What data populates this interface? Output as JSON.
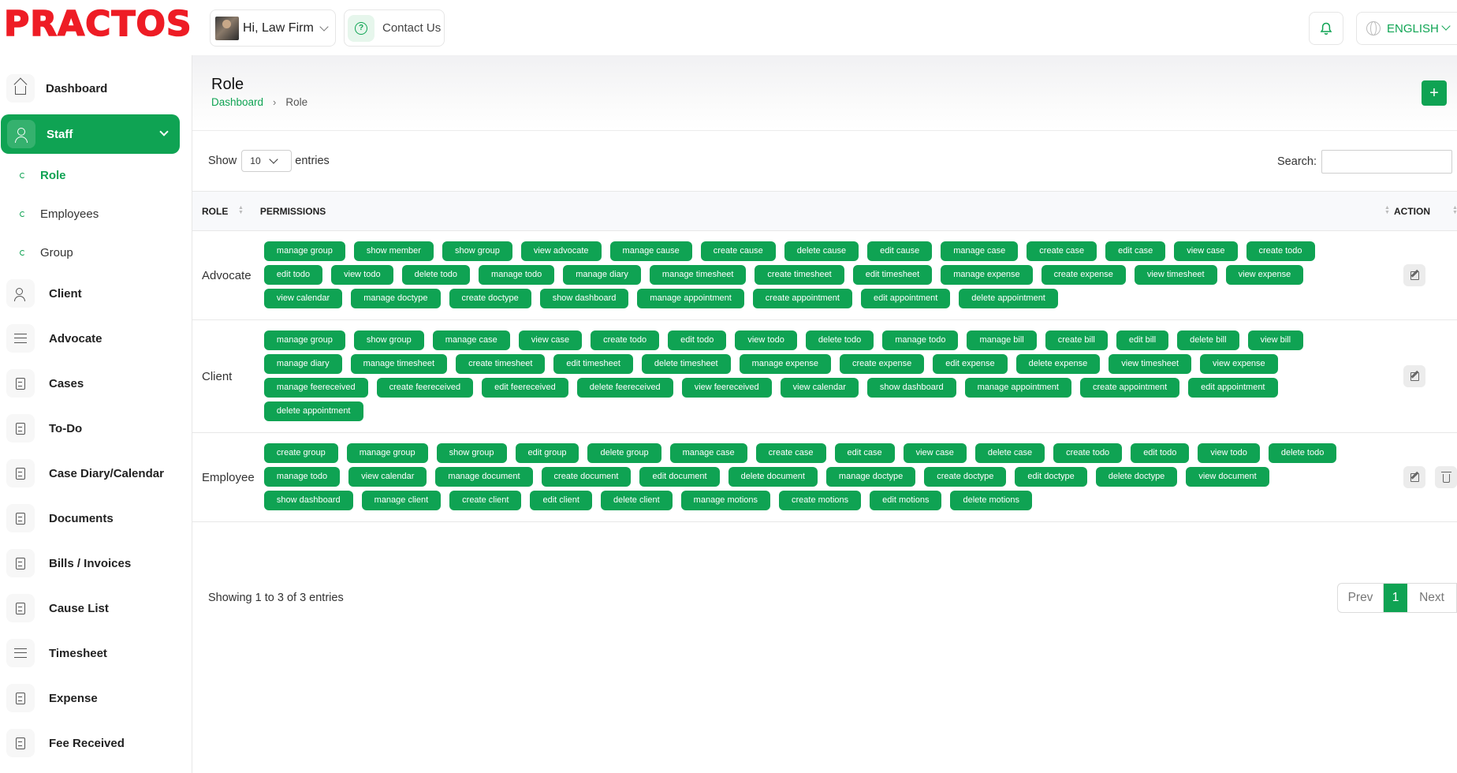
{
  "brand": {
    "logo_text": "PRACTOS"
  },
  "header": {
    "user_greeting": "Hi, Law Firm",
    "contact_label": "Contact Us",
    "language": "ENGLISH"
  },
  "sidebar": {
    "items": [
      {
        "label": "Dashboard",
        "icon": "home-icon"
      },
      {
        "label": "Staff",
        "icon": "users-icon",
        "active": true
      },
      {
        "label": "Client",
        "icon": "user-check-icon"
      },
      {
        "label": "Advocate",
        "icon": "list-check-icon"
      },
      {
        "label": "Cases",
        "icon": "file-icon"
      },
      {
        "label": "To-Do",
        "icon": "file-plus-icon"
      },
      {
        "label": "Case Diary/Calendar",
        "icon": "notebook-icon"
      },
      {
        "label": "Documents",
        "icon": "copy-icon"
      },
      {
        "label": "Bills / Invoices",
        "icon": "invoice-icon"
      },
      {
        "label": "Cause List",
        "icon": "clipboard-icon"
      },
      {
        "label": "Timesheet",
        "icon": "list-check-icon"
      },
      {
        "label": "Expense",
        "icon": "receipt-icon"
      },
      {
        "label": "Fee Received",
        "icon": "dollar-file-icon"
      }
    ],
    "staff_submenu": [
      {
        "label": "Role",
        "active": true
      },
      {
        "label": "Employees"
      },
      {
        "label": "Group"
      }
    ]
  },
  "page": {
    "title": "Role",
    "breadcrumb": {
      "home": "Dashboard",
      "separator": "›",
      "current": "Role"
    },
    "add_button": "+"
  },
  "table_controls": {
    "show_label": "Show",
    "entries_value": "10",
    "entries_label": "entries",
    "search_label": "Search:"
  },
  "table": {
    "columns": [
      "ROLE",
      "PERMISSIONS",
      "ACTION"
    ],
    "rows": [
      {
        "role": "Advocate",
        "permissions": [
          "manage group",
          "show member",
          "show group",
          "view advocate",
          "manage cause",
          "create cause",
          "delete cause",
          "edit cause",
          "manage case",
          "create case",
          "edit case",
          "view case",
          "create todo",
          "edit todo",
          "view todo",
          "delete todo",
          "manage todo",
          "manage diary",
          "manage timesheet",
          "create timesheet",
          "edit timesheet",
          "manage expense",
          "create expense",
          "view timesheet",
          "view expense",
          "view calendar",
          "manage doctype",
          "create doctype",
          "show dashboard",
          "manage appointment",
          "create appointment",
          "edit appointment",
          "delete appointment"
        ],
        "actions": [
          "edit"
        ]
      },
      {
        "role": "Client",
        "permissions": [
          "manage group",
          "show group",
          "manage case",
          "view case",
          "create todo",
          "edit todo",
          "view todo",
          "delete todo",
          "manage todo",
          "manage bill",
          "create bill",
          "edit bill",
          "delete bill",
          "view bill",
          "manage diary",
          "manage timesheet",
          "create timesheet",
          "edit timesheet",
          "delete timesheet",
          "manage expense",
          "create expense",
          "edit expense",
          "delete expense",
          "view timesheet",
          "view expense",
          "manage feereceived",
          "create feereceived",
          "edit feereceived",
          "delete feereceived",
          "view feereceived",
          "view calendar",
          "show dashboard",
          "manage appointment",
          "create appointment",
          "edit appointment",
          "delete appointment"
        ],
        "actions": [
          "edit"
        ]
      },
      {
        "role": "Employee",
        "permissions": [
          "create group",
          "manage group",
          "show group",
          "edit group",
          "delete group",
          "manage case",
          "create case",
          "edit case",
          "view case",
          "delete case",
          "create todo",
          "edit todo",
          "view todo",
          "delete todo",
          "manage todo",
          "view calendar",
          "manage document",
          "create document",
          "edit document",
          "delete document",
          "manage doctype",
          "create doctype",
          "edit doctype",
          "delete doctype",
          "view document",
          "show dashboard",
          "manage client",
          "create client",
          "edit client",
          "delete client",
          "manage motions",
          "create motions",
          "edit motions",
          "delete motions"
        ],
        "actions": [
          "edit",
          "delete"
        ]
      }
    ]
  },
  "footer": {
    "info": "Showing 1 to 3 of 3 entries",
    "prev": "Prev",
    "page": "1",
    "next": "Next"
  },
  "colors": {
    "accent": "#0fa353",
    "logo": "#ee1c25"
  }
}
